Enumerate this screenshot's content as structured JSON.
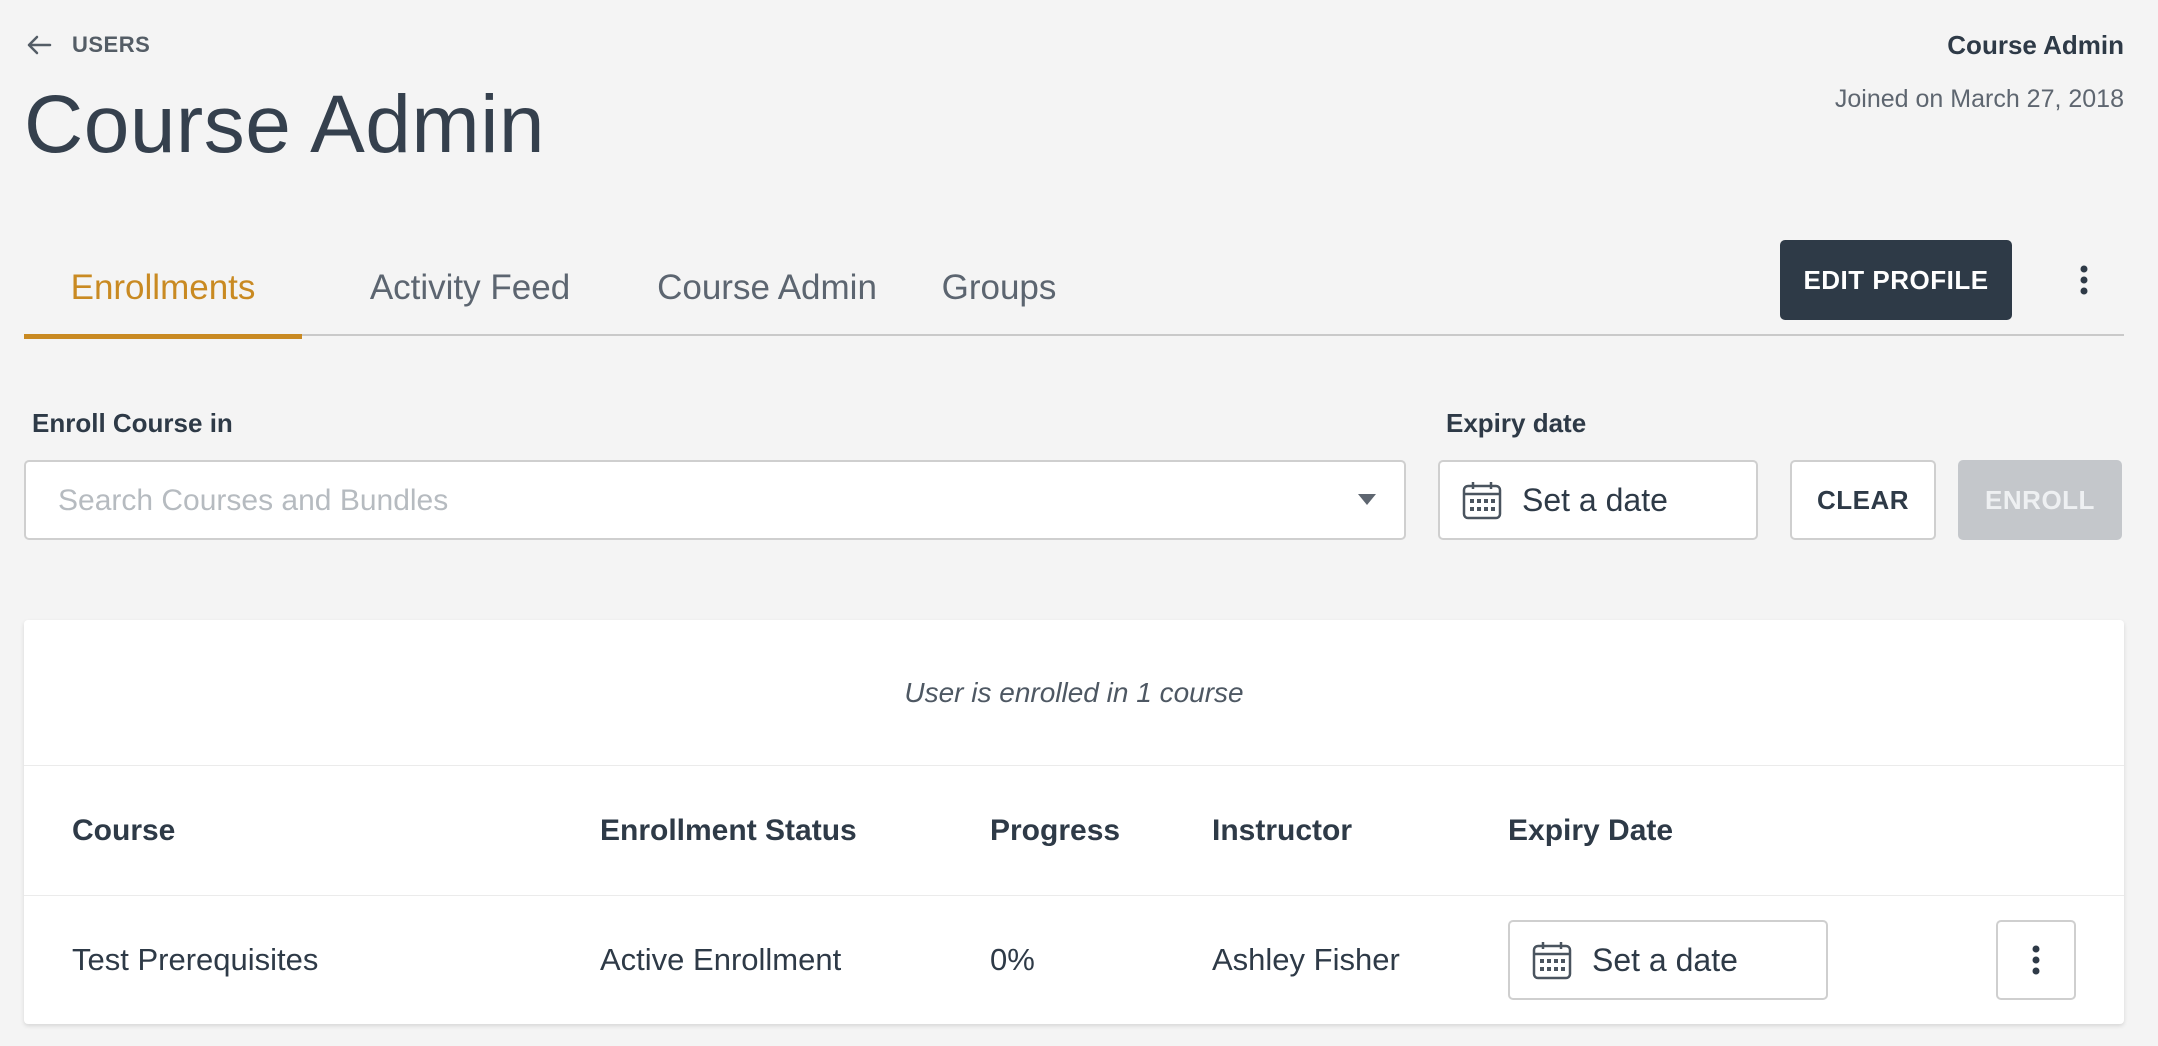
{
  "header": {
    "back_label": "USERS",
    "title": "Course Admin",
    "user_name": "Course Admin",
    "joined_text": "Joined on March 27, 2018"
  },
  "tabs": [
    {
      "label": "Enrollments",
      "active": true
    },
    {
      "label": "Activity Feed",
      "active": false
    },
    {
      "label": "Course Admin",
      "active": false
    },
    {
      "label": "Groups",
      "active": false
    }
  ],
  "actions": {
    "edit_profile_label": "EDIT PROFILE"
  },
  "enroll_form": {
    "course_label": "Enroll Course in",
    "search_placeholder": "Search Courses and Bundles",
    "expiry_label": "Expiry date",
    "date_placeholder": "Set a date",
    "clear_label": "CLEAR",
    "enroll_label": "ENROLL"
  },
  "enrollments": {
    "summary": "User is enrolled in 1 course",
    "columns": [
      "Course",
      "Enrollment Status",
      "Progress",
      "Instructor",
      "Expiry Date"
    ],
    "rows": [
      {
        "course": "Test Prerequisites",
        "status": "Active Enrollment",
        "progress": "0%",
        "instructor": "Ashley Fisher",
        "expiry": "Set a date"
      }
    ]
  },
  "colors": {
    "accent": "#c98a22",
    "primary_dark": "#2e3a47",
    "disabled": "#c4c7cb",
    "background": "#f4f4f4"
  },
  "icons": {
    "back": "arrow-left-icon",
    "more": "kebab-menu-icon",
    "calendar": "calendar-icon",
    "dropdown": "chevron-down-icon"
  }
}
